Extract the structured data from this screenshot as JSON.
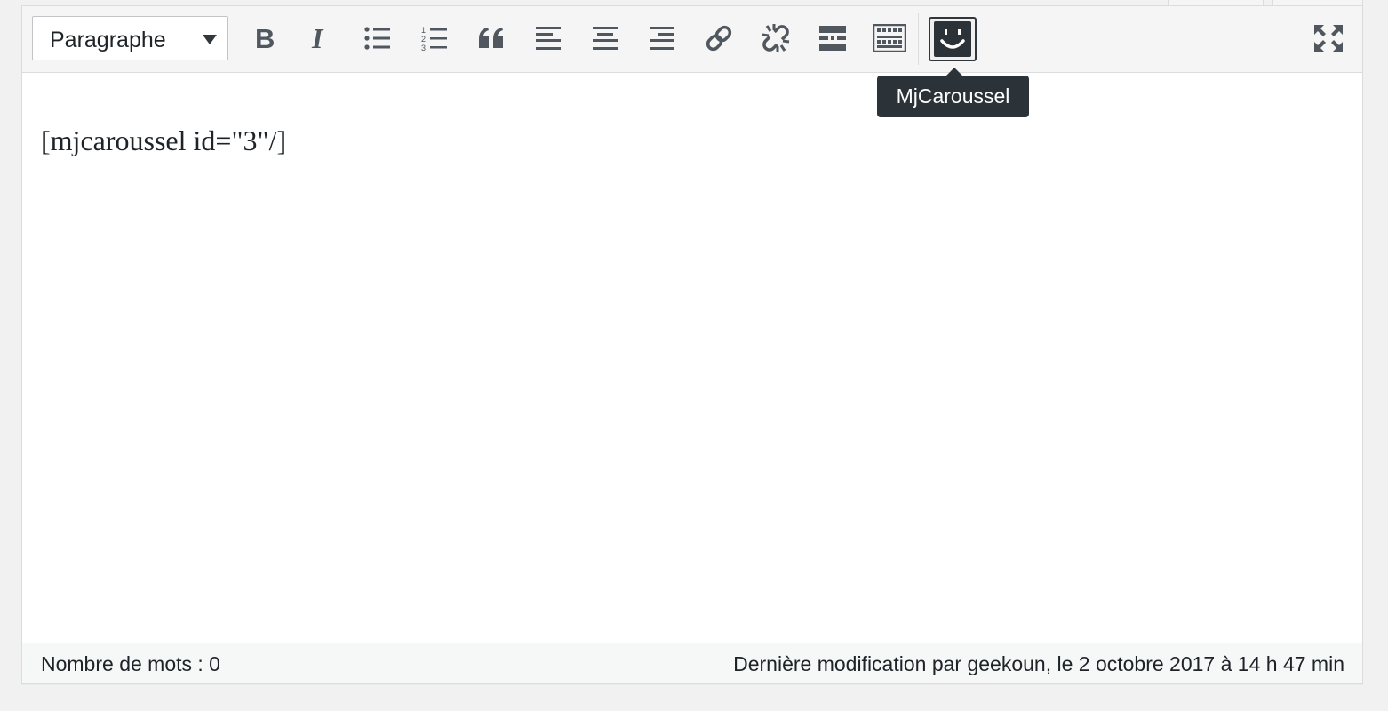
{
  "toolbar": {
    "format_select": {
      "value": "Paragraphe"
    },
    "buttons": [
      {
        "name": "bold",
        "icon": "bold-icon"
      },
      {
        "name": "italic",
        "icon": "italic-icon"
      },
      {
        "name": "bullet-list",
        "icon": "bullet-list-icon"
      },
      {
        "name": "numbered-list",
        "icon": "numbered-list-icon"
      },
      {
        "name": "blockquote",
        "icon": "quote-icon"
      },
      {
        "name": "align-left",
        "icon": "align-left-icon"
      },
      {
        "name": "align-center",
        "icon": "align-center-icon"
      },
      {
        "name": "align-right",
        "icon": "align-right-icon"
      },
      {
        "name": "insert-link",
        "icon": "link-icon"
      },
      {
        "name": "remove-link",
        "icon": "unlink-icon"
      },
      {
        "name": "read-more",
        "icon": "read-more-icon"
      },
      {
        "name": "toolbar-toggle",
        "icon": "keyboard-icon"
      },
      {
        "name": "mjcaroussel",
        "icon": "smiley-icon"
      },
      {
        "name": "fullscreen",
        "icon": "fullscreen-icon"
      }
    ],
    "tooltip": "MjCaroussel"
  },
  "content": {
    "text": "[mjcaroussel id=\"3\"/]"
  },
  "statusbar": {
    "word_count": "Nombre de mots : 0",
    "last_edit": "Dernière modification par geekoun, le 2 octobre 2017 à 14 h 47 min"
  },
  "colors": {
    "icon": "#50575e",
    "tooltip_bg": "#2c3338",
    "toolbar_bg": "#f5f5f5",
    "page_bg": "#f1f1f1"
  }
}
